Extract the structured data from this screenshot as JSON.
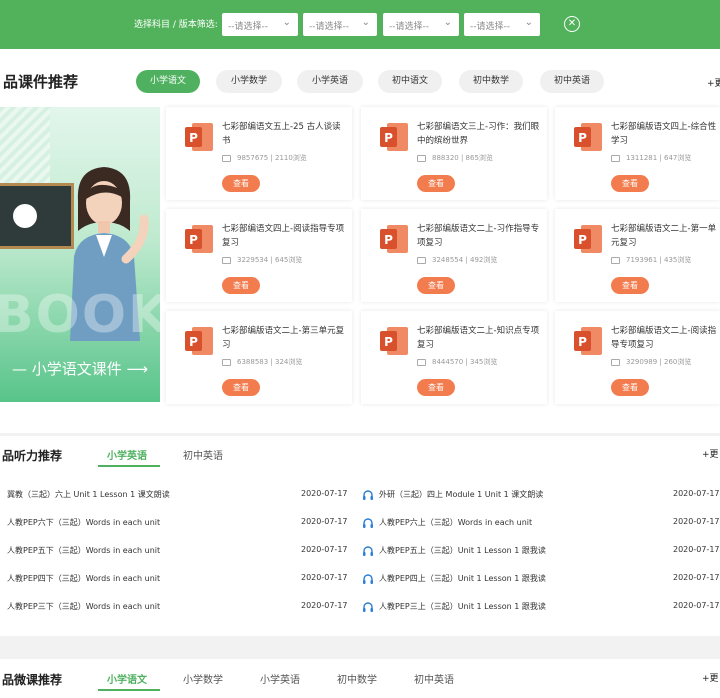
{
  "filter": {
    "label": "选择科目 / 版本筛选:",
    "selects": [
      "--请选择--",
      "--请选择--",
      "--请选择--",
      "--请选择--"
    ]
  },
  "courseware": {
    "title": "品课件推荐",
    "tabs": [
      "小学语文",
      "小学数学",
      "小学英语",
      "初中语文",
      "初中数学",
      "初中英语"
    ],
    "more": "+更",
    "banner_book": "BOOK",
    "banner_text": "— 小学语文课件 ⟶",
    "view_label": "查看",
    "cards": [
      {
        "title": "七彩部编语文五上-25 古人谈读书",
        "meta": "9857675 | 2110浏览"
      },
      {
        "title": "七彩部编语文三上-习作：我们眼中的缤纷世界",
        "meta": "888320 | 865浏览"
      },
      {
        "title": "七彩部编版语文四上-综合性学习",
        "meta": "1311281 | 647浏览"
      },
      {
        "title": "七彩部编语文四上-阅读指导专项复习",
        "meta": "3229534 | 645浏览"
      },
      {
        "title": "七彩部编版语文二上-习作指导专项复习",
        "meta": "3248554 | 492浏览"
      },
      {
        "title": "七彩部编版语文二上-第一单元复习",
        "meta": "7193961 | 435浏览"
      },
      {
        "title": "七彩部编版语文二上-第三单元复习",
        "meta": "6388583 | 324浏览"
      },
      {
        "title": "七彩部编版语文二上-知识点专项复习",
        "meta": "8444570 | 345浏览"
      },
      {
        "title": "七彩部编版语文二上-阅读指导专项复习",
        "meta": "3290989 | 260浏览"
      }
    ]
  },
  "audio": {
    "title": "品听力推荐",
    "tabs": [
      "小学英语",
      "初中英语"
    ],
    "more": "+更",
    "left": [
      {
        "title": "冀教（三起）六上 Unit 1 Lesson 1 课文朗读",
        "date": "2020-07-17"
      },
      {
        "title": "人教PEP六下（三起）Words in each unit",
        "date": "2020-07-17"
      },
      {
        "title": "人教PEP五下（三起）Words in each unit",
        "date": "2020-07-17"
      },
      {
        "title": "人教PEP四下（三起）Words in each unit",
        "date": "2020-07-17"
      },
      {
        "title": "人教PEP三下（三起）Words in each unit",
        "date": "2020-07-17"
      }
    ],
    "right": [
      {
        "title": "外研（三起）四上 Module 1 Unit 1 课文朗读",
        "date": "2020-07-17"
      },
      {
        "title": "人教PEP六上（三起）Words in each unit",
        "date": "2020-07-17"
      },
      {
        "title": "人教PEP五上（三起）Unit 1 Lesson 1 跟我读",
        "date": "2020-07-17"
      },
      {
        "title": "人教PEP四上（三起）Unit 1 Lesson 1 跟我读",
        "date": "2020-07-17"
      },
      {
        "title": "人教PEP三上（三起）Unit 1 Lesson 1 跟我读",
        "date": "2020-07-17"
      }
    ]
  },
  "micro": {
    "title": "品微课推荐",
    "tabs": [
      "小学语文",
      "小学数学",
      "小学英语",
      "初中数学",
      "初中英语"
    ],
    "more": "+更"
  },
  "colors": {
    "brand_green": "#52b25c",
    "view_button": "#f27c4e",
    "ppt_orange": "#d9502d"
  }
}
